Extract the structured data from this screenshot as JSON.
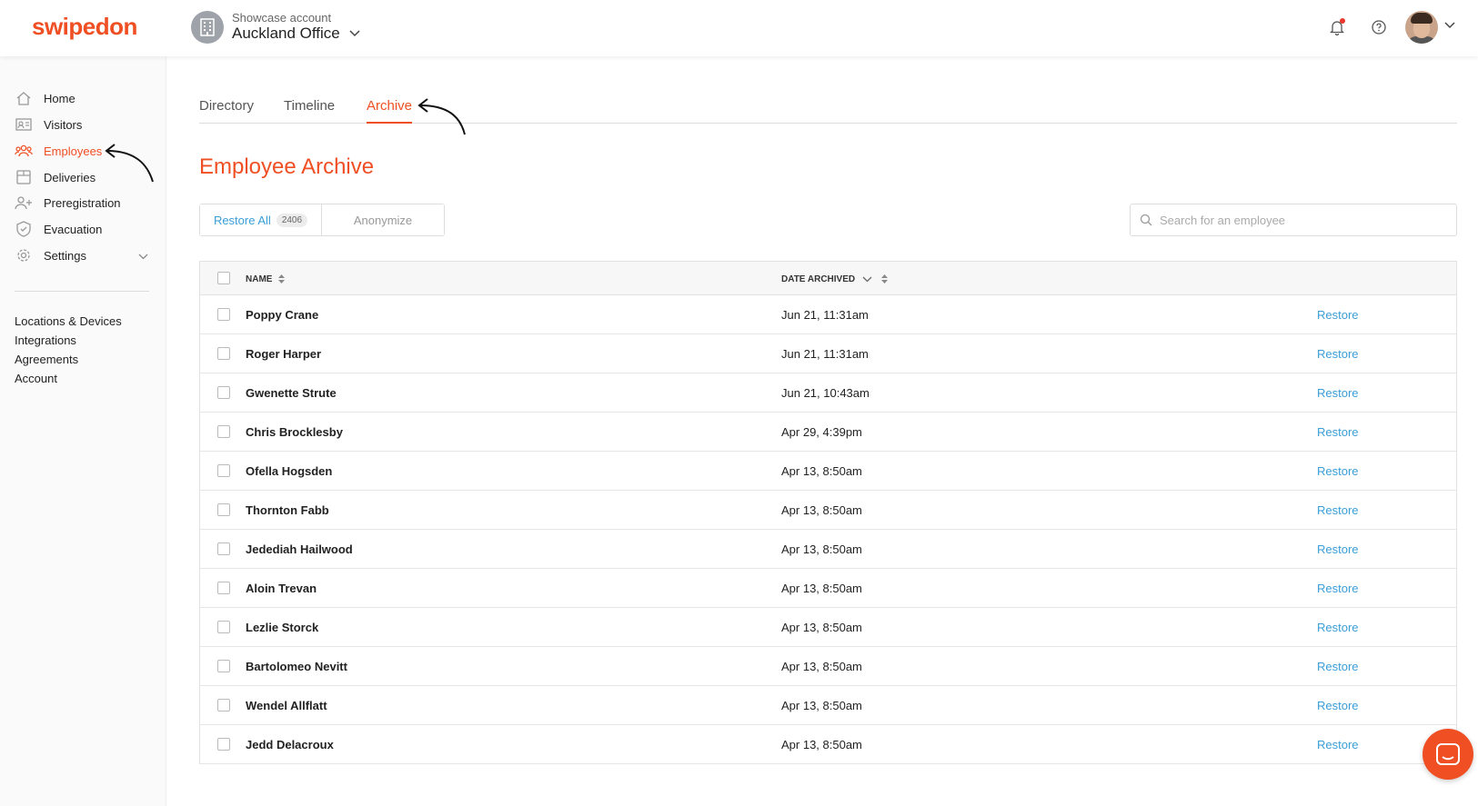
{
  "brand": {
    "logo_text": "swipedon",
    "accent": "#ef4f23",
    "link_color": "#3a9ed8"
  },
  "account": {
    "label": "Showcase account",
    "name": "Auckland Office"
  },
  "sidebar": {
    "items": [
      {
        "label": "Home",
        "icon": "home-icon"
      },
      {
        "label": "Visitors",
        "icon": "visitor-card-icon"
      },
      {
        "label": "Employees",
        "icon": "employees-icon",
        "active": true
      },
      {
        "label": "Deliveries",
        "icon": "package-icon"
      },
      {
        "label": "Preregistration",
        "icon": "add-user-icon"
      },
      {
        "label": "Evacuation",
        "icon": "shield-icon"
      },
      {
        "label": "Settings",
        "icon": "gear-icon"
      }
    ],
    "links": [
      "Locations & Devices",
      "Integrations",
      "Agreements",
      "Account"
    ]
  },
  "tabs": [
    {
      "label": "Directory"
    },
    {
      "label": "Timeline"
    },
    {
      "label": "Archive",
      "active": true
    }
  ],
  "page_title": "Employee Archive",
  "actions": {
    "restore_all": "Restore All",
    "count": "2406",
    "anonymize": "Anonymize"
  },
  "search": {
    "placeholder": "Search for an employee"
  },
  "table": {
    "columns": {
      "name": "NAME",
      "date": "DATE ARCHIVED"
    },
    "action_label": "Restore",
    "rows": [
      {
        "name": "Poppy Crane",
        "date": "Jun 21, 11:31am"
      },
      {
        "name": "Roger Harper",
        "date": "Jun 21, 11:31am"
      },
      {
        "name": "Gwenette Strute",
        "date": "Jun 21, 10:43am"
      },
      {
        "name": "Chris Brocklesby",
        "date": "Apr 29, 4:39pm"
      },
      {
        "name": "Ofella Hogsden",
        "date": "Apr 13, 8:50am"
      },
      {
        "name": "Thornton Fabb",
        "date": "Apr 13, 8:50am"
      },
      {
        "name": "Jedediah Hailwood",
        "date": "Apr 13, 8:50am"
      },
      {
        "name": "Aloin Trevan",
        "date": "Apr 13, 8:50am"
      },
      {
        "name": "Lezlie Storck",
        "date": "Apr 13, 8:50am"
      },
      {
        "name": "Bartolomeo Nevitt",
        "date": "Apr 13, 8:50am"
      },
      {
        "name": "Wendel Allflatt",
        "date": "Apr 13, 8:50am"
      },
      {
        "name": "Jedd Delacroux",
        "date": "Apr 13, 8:50am"
      }
    ]
  }
}
